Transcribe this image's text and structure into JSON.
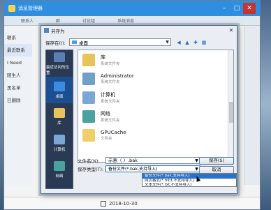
{
  "main_window": {
    "title": "消息管理器",
    "toolbar": [
      "联系人",
      "群",
      "讨论组",
      "系统消息"
    ],
    "sidebar": [
      "联系",
      "最近联系",
      "I Need",
      "陌生人",
      "黑名单",
      "已删除"
    ],
    "footer_date": "2018-10-30",
    "colors": {
      "titlebar": "#2e8fe0",
      "close": "#c8322f"
    }
  },
  "dialog": {
    "title": "另存为",
    "save_in_label": "保存在(I):",
    "save_in_value": "桌面",
    "places": [
      {
        "label": "最近访问的位置",
        "icon": "recent-places-icon"
      },
      {
        "label": "桌面",
        "icon": "desktop-icon"
      },
      {
        "label": "库",
        "icon": "library-icon"
      },
      {
        "label": "计算机",
        "icon": "computer-icon"
      },
      {
        "label": "网络",
        "icon": "network-icon"
      }
    ],
    "files": [
      {
        "name": "库",
        "sub": "系统文件夹",
        "icon": "library-folder-icon"
      },
      {
        "name": "Administrator",
        "sub": "系统文件夹",
        "icon": "user-folder-icon"
      },
      {
        "name": "计算机",
        "sub": "系统文件夹",
        "icon": "computer-icon"
      },
      {
        "name": "网络",
        "sub": "系统文件夹",
        "icon": "network-icon"
      },
      {
        "name": "GPUCache",
        "sub": "文件夹",
        "icon": "folder-icon"
      }
    ],
    "filename_label": "文件名(N):",
    "filename_value": "示意（        ）.bak",
    "type_label": "保存类型(T):",
    "type_value": "备份文件(*.bak,支持导入)",
    "type_options": [
      "备份文件(*.bak,支持导入)",
      "网页格式(*.mht,不支持导入)",
      "文本文件(*.txt,不支持导入)"
    ],
    "save_button": "保存(S)",
    "cancel_button": "取消"
  }
}
